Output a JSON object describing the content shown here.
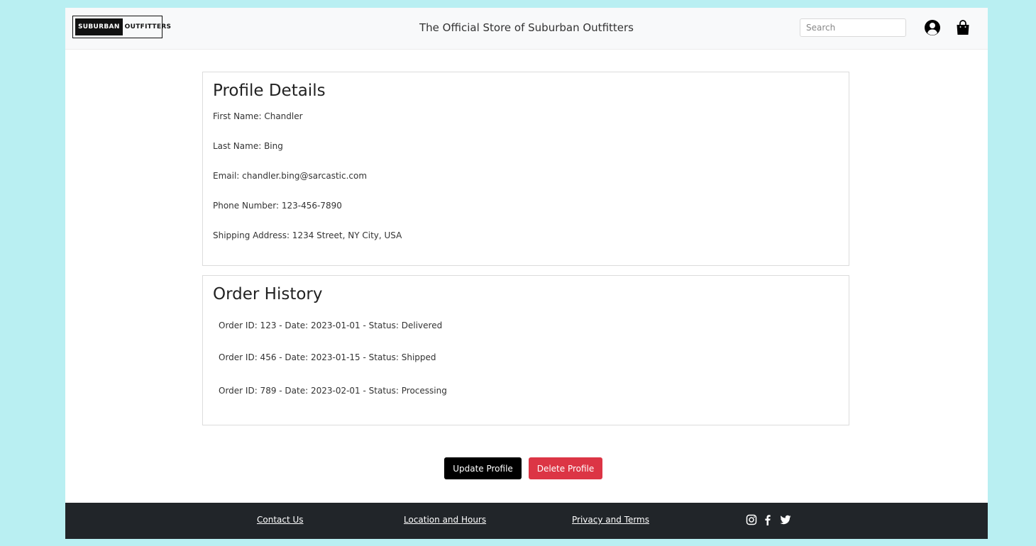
{
  "header": {
    "logo": {
      "dark_text": "SUBURBAN",
      "light_text": "OUTFITTERS"
    },
    "tagline": "The Official Store of Suburban Outfitters",
    "search_placeholder": "Search",
    "icons": [
      "user-circle-icon",
      "shopping-bag-icon"
    ]
  },
  "profile": {
    "title": "Profile Details",
    "fields": [
      "First Name: Chandler",
      "Last Name: Bing",
      "Email: chandler.bing@sarcastic.com",
      "Phone Number: 123-456-7890",
      "Shipping Address: 1234 Street, NY City, USA"
    ]
  },
  "orders": {
    "title": "Order History",
    "items": [
      "Order ID: 123 - Date: 2023-01-01 - Status: Delivered",
      "Order ID: 456 - Date: 2023-01-15 - Status: Shipped",
      "Order ID: 789 - Date: 2023-02-01 - Status: Processing"
    ]
  },
  "actions": {
    "update_label": "Update Profile",
    "delete_label": "Delete Profile"
  },
  "footer": {
    "links": [
      "Contact Us",
      "Location and Hours",
      "Privacy and Terms"
    ],
    "social_icons": [
      "instagram-icon",
      "facebook-icon",
      "twitter-icon"
    ]
  },
  "colors": {
    "background": "#b9eff2",
    "delete": "#dc3545",
    "footer": "#212529"
  }
}
